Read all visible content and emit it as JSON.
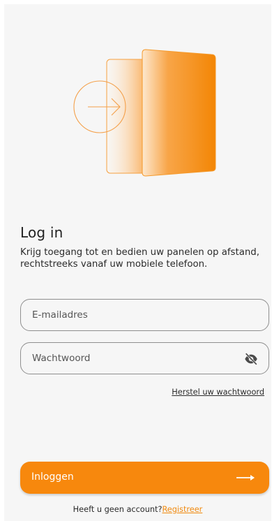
{
  "colors": {
    "accent": "#f7880d",
    "background": "#f6f6f6",
    "text": "#2b2b2b",
    "link": "#f08a10"
  },
  "illustration": {
    "icon": "door-arrow-icon"
  },
  "login": {
    "title": "Log in",
    "subtitle": "Krijg toegang tot en bedien uw panelen op afstand, rechtstreeks vanaf uw mobiele telefoon."
  },
  "form": {
    "email_placeholder": "E-mailadres",
    "password_placeholder": "Wachtwoord",
    "password_toggle_icon": "eye-off-icon",
    "forgot_password": "Herstel uw wachtwoord"
  },
  "actions": {
    "login_label": "Inloggen",
    "login_icon": "arrow-right-icon"
  },
  "footer": {
    "prompt": "Heeft u geen account?",
    "register": "Registreer"
  }
}
